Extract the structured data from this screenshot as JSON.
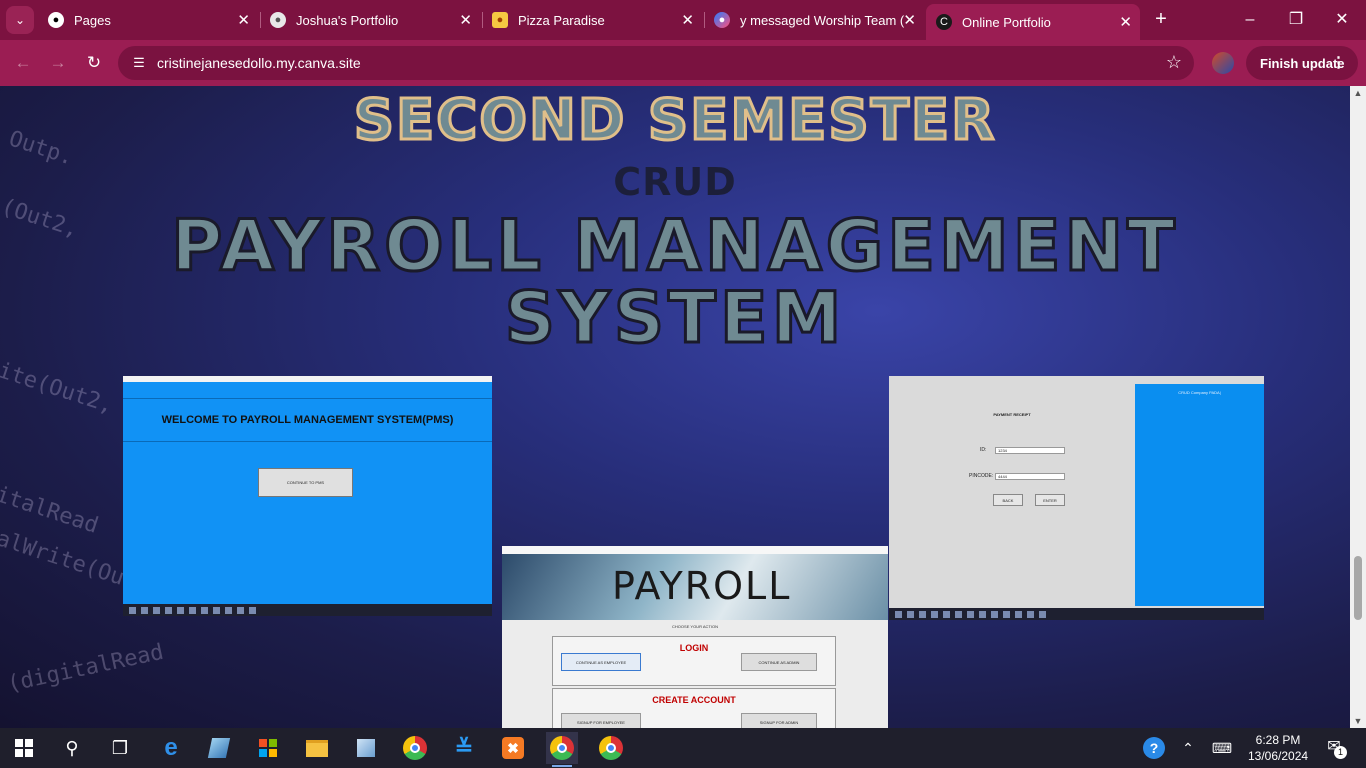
{
  "browser": {
    "tabs": [
      {
        "label": "Pages",
        "icon": "github-icon"
      },
      {
        "label": "Joshua's Portfolio",
        "icon": "globe-icon"
      },
      {
        "label": "Pizza Paradise",
        "icon": "pizza-icon"
      },
      {
        "label": "у messaged Worship Team (",
        "icon": "messenger-icon"
      },
      {
        "label": "Online Portfolio",
        "icon": "canva-icon"
      }
    ],
    "url": "cristinejanesedollo.my.canva.site",
    "update_label": "Finish update",
    "accent_color": "#7c1240"
  },
  "page": {
    "heading_semester": "SECOND SEMESTER",
    "heading_crud": "CRUD",
    "heading_title_line1": "PAYROLL MANAGEMENT",
    "heading_title_line2": "SYSTEM",
    "shot_welcome": {
      "welcome_text": "WELCOME TO PAYROLL MANAGEMENT SYSTEM(PMS)",
      "continue_label": "CONTINUE TO PMS"
    },
    "shot_login": {
      "banner_word": "PAYROLL",
      "choose_text": "CHOOSE YOUR ACTION",
      "login_title": "LOGIN",
      "continue_employee": "CONTINUE AS EMPLOYEE",
      "continue_admin": "CONTINUE AS ADMIN",
      "create_title": "CREATE ACCOUNT",
      "signup_employee": "SIGNUP FOR EMPLOYEE",
      "signup_admin": "SIGNUP FOR ADMIN"
    },
    "shot_receipt": {
      "title": "PAYMENT RECEIPT",
      "id_label": "ID:",
      "id_value": "1234",
      "pin_label": "PINCODE:",
      "pin_value": "4444",
      "back_label": "BACK",
      "enter_label": "ENTER",
      "company": "CRUD Company PADA|"
    }
  },
  "taskbar": {
    "time": "6:28 PM",
    "date": "13/06/2024",
    "notification_count": "1"
  }
}
